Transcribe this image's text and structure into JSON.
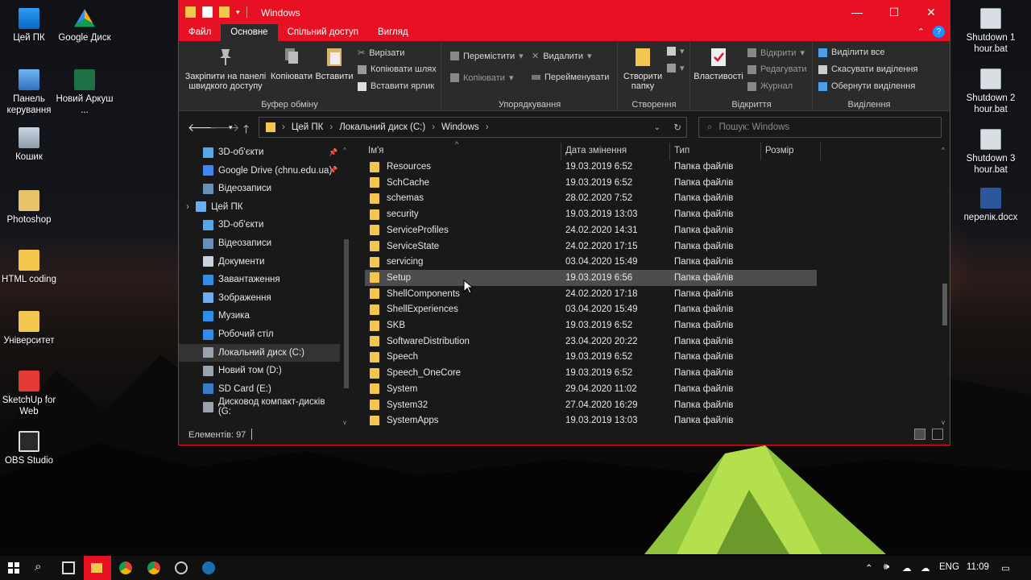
{
  "desktop": {
    "left_icons": [
      {
        "label": "Цей ПК",
        "icon": "this-pc-icon"
      },
      {
        "label": "Google Диск",
        "icon": "google-drive-icon"
      },
      {
        "label": "Панель керування",
        "icon": "control-panel-icon"
      },
      {
        "label": "Новий Аркуш ...",
        "icon": "excel-file-icon"
      },
      {
        "label": "Кошик",
        "icon": "recycle-bin-icon"
      },
      {
        "label": "Photoshop",
        "icon": "photoshop-icon"
      },
      {
        "label": "HTML coding",
        "icon": "folder-icon"
      },
      {
        "label": "Університет",
        "icon": "folder-icon"
      },
      {
        "label": "SketchUp for Web",
        "icon": "sketchup-icon"
      },
      {
        "label": "OBS Studio",
        "icon": "obs-icon"
      }
    ],
    "right_icons": [
      {
        "label": "Shutdown 1 hour.bat",
        "icon": "batch-file-icon"
      },
      {
        "label": "Shutdown 2 hour.bat",
        "icon": "batch-file-icon"
      },
      {
        "label": "Shutdown 3 hour.bat",
        "icon": "batch-file-icon"
      },
      {
        "label": "перелік.docx",
        "icon": "word-file-icon"
      }
    ]
  },
  "window": {
    "title": "Windows",
    "controls": {
      "minimize": "—",
      "maximize": "☐",
      "close": "✕"
    },
    "accent": "#e81123"
  },
  "ribbon": {
    "tabs": [
      "Файл",
      "Основне",
      "Спільний доступ",
      "Вигляд"
    ],
    "clipboard": {
      "pin": "Закріпити на панелі швидкого доступу",
      "copy": "Копіювати",
      "paste": "Вставити",
      "cut": "Вирізати",
      "copy_path": "Копіювати шлях",
      "paste_shortcut": "Вставити ярлик",
      "label": "Буфер обміну"
    },
    "organize": {
      "move_to": "Перемістити",
      "copy_to": "Копіювати",
      "delete": "Видалити",
      "rename": "Перейменувати",
      "label": "Упорядкування"
    },
    "new": {
      "new_folder": "Створити папку",
      "label": "Створення"
    },
    "open": {
      "properties": "Властивості",
      "open": "Відкрити",
      "edit": "Редагувати",
      "history": "Журнал",
      "label": "Відкриття"
    },
    "select": {
      "select_all": "Виділити все",
      "select_none": "Скасувати виділення",
      "invert": "Обернути виділення",
      "label": "Виділення"
    }
  },
  "address": {
    "path": [
      "Цей ПК",
      "Локальний диск (C:)",
      "Windows"
    ],
    "search_placeholder": "Пошук: Windows"
  },
  "nav_pane": [
    {
      "label": "3D-об'єкти",
      "indent": 1,
      "pinned": true,
      "selected": false
    },
    {
      "label": "Google Drive (chnu.edu.ua)",
      "indent": 1,
      "pinned": true,
      "selected": false
    },
    {
      "label": "Відеозаписи",
      "indent": 1,
      "pinned": false,
      "selected": false
    },
    {
      "label": "Цей ПК",
      "indent": 0,
      "pinned": false,
      "selected": false
    },
    {
      "label": "3D-об'єкти",
      "indent": 1,
      "pinned": false,
      "selected": false
    },
    {
      "label": "Відеозаписи",
      "indent": 1,
      "pinned": false,
      "selected": false
    },
    {
      "label": "Документи",
      "indent": 1,
      "pinned": false,
      "selected": false
    },
    {
      "label": "Завантаження",
      "indent": 1,
      "pinned": false,
      "selected": false
    },
    {
      "label": "Зображення",
      "indent": 1,
      "pinned": false,
      "selected": false
    },
    {
      "label": "Музика",
      "indent": 1,
      "pinned": false,
      "selected": false
    },
    {
      "label": "Робочий стіл",
      "indent": 1,
      "pinned": false,
      "selected": false
    },
    {
      "label": "Локальний диск (C:)",
      "indent": 1,
      "pinned": false,
      "selected": true
    },
    {
      "label": "Новий том (D:)",
      "indent": 1,
      "pinned": false,
      "selected": false
    },
    {
      "label": "SD Card (E:)",
      "indent": 1,
      "pinned": false,
      "selected": false
    },
    {
      "label": "Дисковод компакт-дисків (G:",
      "indent": 1,
      "pinned": false,
      "selected": false
    }
  ],
  "columns": {
    "name": "Ім'я",
    "date": "Дата змінення",
    "type": "Тип",
    "size": "Розмір"
  },
  "files": [
    {
      "name": "Resources",
      "date": "19.03.2019 6:52",
      "type": "Папка файлів"
    },
    {
      "name": "SchCache",
      "date": "19.03.2019 6:52",
      "type": "Папка файлів"
    },
    {
      "name": "schemas",
      "date": "28.02.2020 7:52",
      "type": "Папка файлів"
    },
    {
      "name": "security",
      "date": "19.03.2019 13:03",
      "type": "Папка файлів"
    },
    {
      "name": "ServiceProfiles",
      "date": "24.02.2020 14:31",
      "type": "Папка файлів"
    },
    {
      "name": "ServiceState",
      "date": "24.02.2020 17:15",
      "type": "Папка файлів"
    },
    {
      "name": "servicing",
      "date": "03.04.2020 15:49",
      "type": "Папка файлів"
    },
    {
      "name": "Setup",
      "date": "19.03.2019 6:56",
      "type": "Папка файлів",
      "selected": true
    },
    {
      "name": "ShellComponents",
      "date": "24.02.2020 17:18",
      "type": "Папка файлів"
    },
    {
      "name": "ShellExperiences",
      "date": "03.04.2020 15:49",
      "type": "Папка файлів"
    },
    {
      "name": "SKB",
      "date": "19.03.2019 6:52",
      "type": "Папка файлів"
    },
    {
      "name": "SoftwareDistribution",
      "date": "23.04.2020 20:22",
      "type": "Папка файлів"
    },
    {
      "name": "Speech",
      "date": "19.03.2019 6:52",
      "type": "Папка файлів"
    },
    {
      "name": "Speech_OneCore",
      "date": "19.03.2019 6:52",
      "type": "Папка файлів"
    },
    {
      "name": "System",
      "date": "29.04.2020 11:02",
      "type": "Папка файлів"
    },
    {
      "name": "System32",
      "date": "27.04.2020 16:29",
      "type": "Папка файлів"
    },
    {
      "name": "SystemApps",
      "date": "19.03.2019 13:03",
      "type": "Папка файлів"
    }
  ],
  "status": {
    "items": "Елементів: 97"
  },
  "taskbar": {
    "language": "ENG",
    "time": "11:09"
  },
  "colors": {
    "folder": "#f3c74d",
    "accent": "#e81123",
    "dark_bg": "#191919"
  }
}
